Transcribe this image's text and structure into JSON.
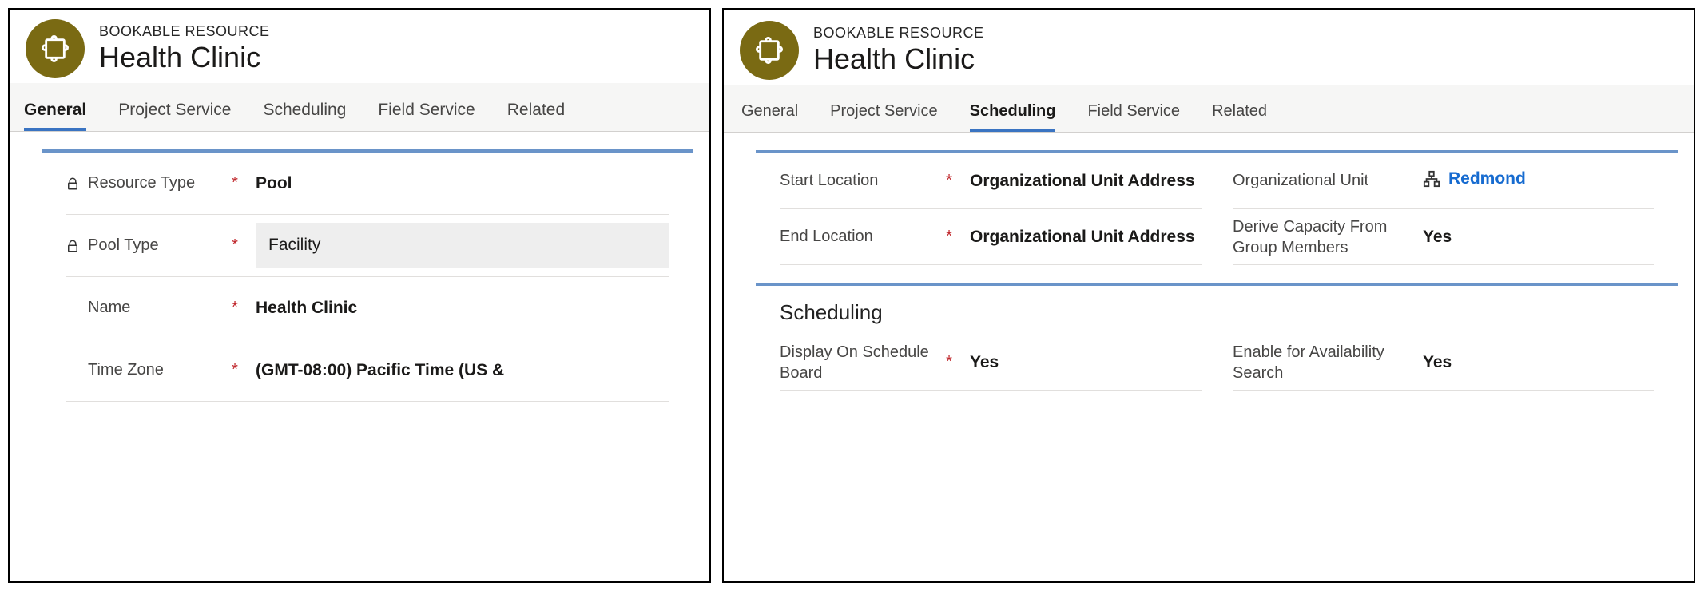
{
  "left": {
    "entity_type": "BOOKABLE RESOURCE",
    "entity_name": "Health Clinic",
    "tabs": [
      {
        "label": "General",
        "active": true
      },
      {
        "label": "Project Service",
        "active": false
      },
      {
        "label": "Scheduling",
        "active": false
      },
      {
        "label": "Field Service",
        "active": false
      },
      {
        "label": "Related",
        "active": false
      }
    ],
    "fields": {
      "resource_type": {
        "label": "Resource Type",
        "value": "Pool",
        "locked": true,
        "required": true
      },
      "pool_type": {
        "label": "Pool Type",
        "value": "Facility",
        "locked": true,
        "required": true
      },
      "name": {
        "label": "Name",
        "value": "Health Clinic",
        "locked": false,
        "required": true
      },
      "time_zone": {
        "label": "Time Zone",
        "value": "(GMT-08:00) Pacific Time (US &",
        "locked": false,
        "required": true
      }
    }
  },
  "right": {
    "entity_type": "BOOKABLE RESOURCE",
    "entity_name": "Health Clinic",
    "tabs": [
      {
        "label": "General",
        "active": false
      },
      {
        "label": "Project Service",
        "active": false
      },
      {
        "label": "Scheduling",
        "active": true
      },
      {
        "label": "Field Service",
        "active": false
      },
      {
        "label": "Related",
        "active": false
      }
    ],
    "section1": {
      "start_location": {
        "label": "Start Location",
        "value": "Organizational Unit Address",
        "required": true
      },
      "end_location": {
        "label": "End Location",
        "value": "Organizational Unit Address",
        "required": true
      },
      "org_unit": {
        "label": "Organizational Unit",
        "value": "Redmond"
      },
      "derive_capacity": {
        "label": "Derive Capacity From Group Members",
        "value": "Yes"
      }
    },
    "section2": {
      "title": "Scheduling",
      "display_on_board": {
        "label": "Display On Schedule Board",
        "value": "Yes",
        "required": true
      },
      "enable_avail": {
        "label": "Enable for Availability Search",
        "value": "Yes"
      }
    }
  }
}
